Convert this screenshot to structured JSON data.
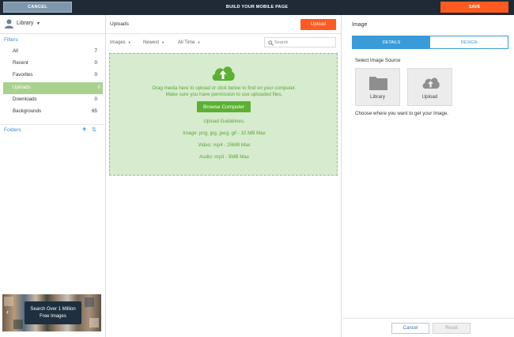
{
  "topbar": {
    "cancel_label": "CANCEL",
    "title": "BUILD YOUR MOBILE PAGE",
    "save_label": "SAVE"
  },
  "sidebar": {
    "library_label": "Library",
    "filters_title": "Filters",
    "filters": [
      {
        "label": "All",
        "count": "7",
        "active": false
      },
      {
        "label": "Recent",
        "count": "0",
        "active": false
      },
      {
        "label": "Favorites",
        "count": "0",
        "active": false
      },
      {
        "label": "Uploads",
        "count": "0",
        "active": true
      },
      {
        "label": "Downloads",
        "count": "0",
        "active": false
      },
      {
        "label": "Backgrounds",
        "count": "65",
        "active": false
      }
    ],
    "folders_title": "Folders",
    "promo_line1": "Search Over 1 Million",
    "promo_line2": "Free Images"
  },
  "main": {
    "title": "Uploads",
    "upload_label": "Upload",
    "type_filter": "Images",
    "sort_filter": "Newest",
    "time_filter": "All Time",
    "search_placeholder": "Search",
    "dropzone": {
      "line1": "Drag media here to upload or click below to find on your computer.",
      "line2": "Make sure you have permission to use uploaded files.",
      "browse_label": "Browse Computer",
      "guidelines_title": "Upload Guidelines:",
      "image_rule": "Image:  png, jpg, jpeg, gif - 10 MB Max",
      "video_rule": "Video:  mp4 - 25MB Max",
      "audio_rule": "Audio:  mp3 - 5MB Max"
    }
  },
  "right_panel": {
    "title": "Image",
    "tab_details": "DETAILS",
    "tab_design": "DESIGN",
    "source_label": "Select Image Source",
    "sources": [
      {
        "label": "Library",
        "icon": "folder-icon"
      },
      {
        "label": "Upload",
        "icon": "cloud-upload-icon"
      }
    ],
    "hint": "Choose where you want to get your Image.",
    "cancel_label": "Cancel",
    "reset_label": "Reset"
  },
  "colors": {
    "topbar_bg": "#1f2a36",
    "accent_orange": "#ff5a1f",
    "accent_blue": "#3a9bd9",
    "active_filter_green": "#a8d28e",
    "dropzone_bg": "#d7ebcf",
    "browse_green": "#5cb032"
  }
}
